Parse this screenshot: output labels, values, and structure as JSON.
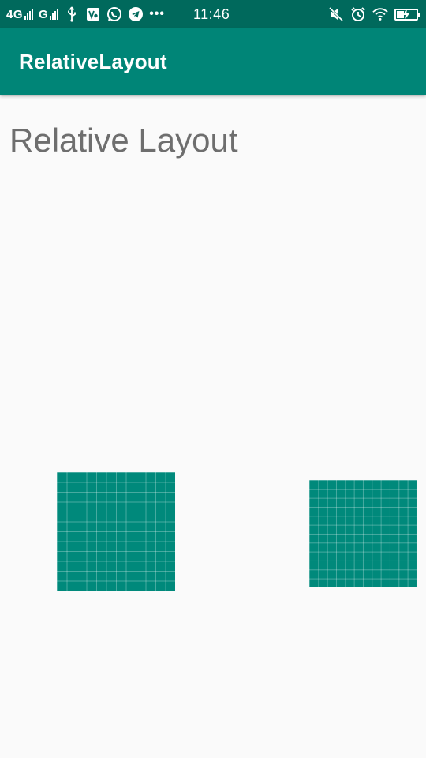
{
  "status_bar": {
    "network_1": "4G",
    "network_2": "G",
    "time": "11:46",
    "overflow": "•••",
    "icons_left": [
      "usb-icon",
      "media-icon",
      "whatsapp-icon",
      "telegram-icon"
    ],
    "icons_right": [
      "mute-icon",
      "alarm-icon",
      "wifi-icon",
      "battery-charging-icon"
    ]
  },
  "app_bar": {
    "title": "RelativeLayout",
    "color": "#008577"
  },
  "content": {
    "heading": "Relative Layout"
  },
  "colors": {
    "status_bar": "#00695c",
    "accent": "#00897b",
    "background": "#fafafa",
    "heading_text": "#6e6e6e"
  }
}
